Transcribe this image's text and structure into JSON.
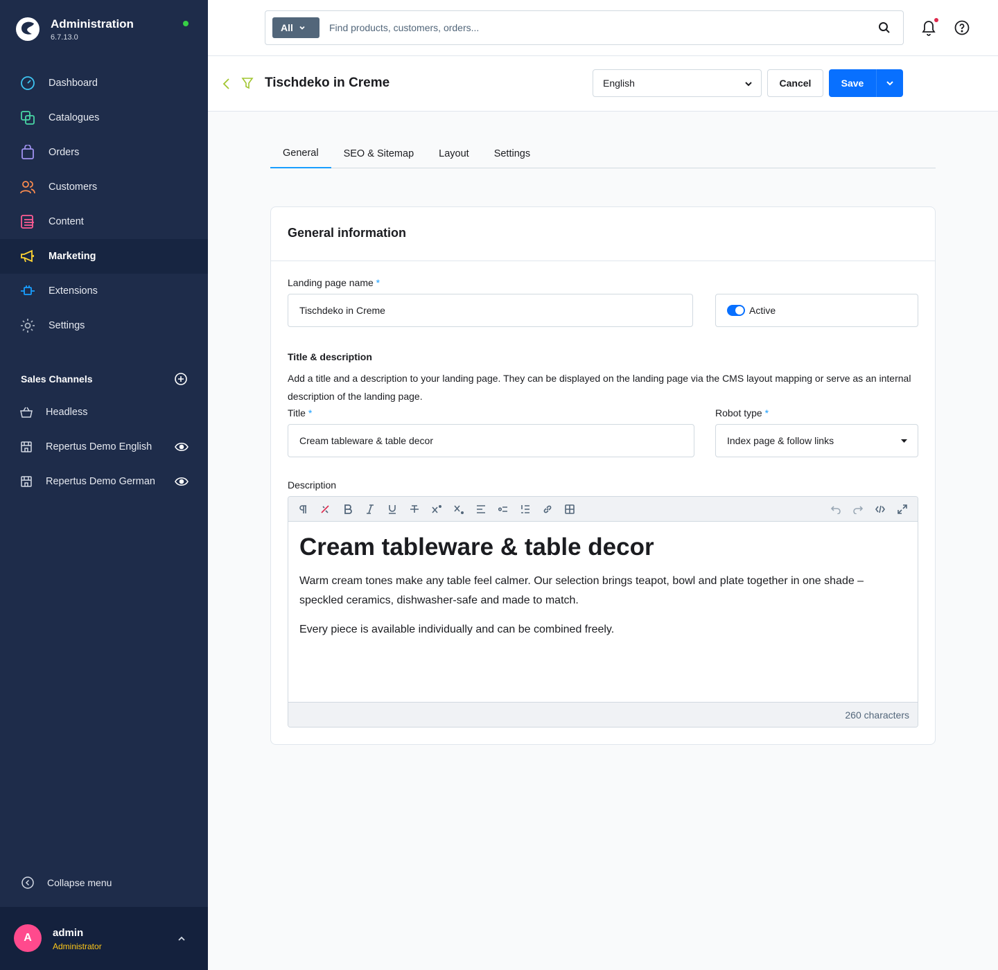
{
  "brand": {
    "title": "Administration",
    "version": "6.7.13.0"
  },
  "nav": {
    "items": [
      {
        "label": "Dashboard",
        "icon": "dashboard-icon"
      },
      {
        "label": "Catalogues",
        "icon": "catalogue-icon"
      },
      {
        "label": "Orders",
        "icon": "shopping-bag-icon"
      },
      {
        "label": "Customers",
        "icon": "users-icon"
      },
      {
        "label": "Content",
        "icon": "content-icon"
      },
      {
        "label": "Marketing",
        "icon": "megaphone-icon",
        "active": true
      },
      {
        "label": "Extensions",
        "icon": "plug-icon"
      },
      {
        "label": "Settings",
        "icon": "gear-icon"
      }
    ]
  },
  "sales_channels": {
    "heading": "Sales Channels",
    "items": [
      {
        "label": "Headless"
      },
      {
        "label": "Repertus Demo English"
      },
      {
        "label": "Repertus Demo German"
      }
    ]
  },
  "sidebar_footer": {
    "collapse_label": "Collapse menu",
    "user_initial": "A",
    "user_name": "admin",
    "user_role": "Administrator"
  },
  "search": {
    "type_label": "All",
    "placeholder": "Find products, customers, orders..."
  },
  "smartbar": {
    "title": "Tischdeko in Creme",
    "language": "English",
    "cancel_label": "Cancel",
    "save_label": "Save"
  },
  "tabs": [
    {
      "label": "General",
      "active": true
    },
    {
      "label": "SEO & Sitemap"
    },
    {
      "label": "Layout"
    },
    {
      "label": "Settings"
    }
  ],
  "card": {
    "title": "General information",
    "name_label": "Landing page name",
    "name_value": "Tischdeko in Creme",
    "active_label": "Active",
    "section_title": "Title & description",
    "section_desc": "Add a title and a description to your landing page. They can be displayed on the landing page via the CMS layout mapping or serve as an internal description of the landing page.",
    "title_label": "Title",
    "title_value": "Cream tableware & table decor",
    "robot_label": "Robot type",
    "robot_value": "Index page & follow links",
    "description_label": "Description",
    "required_mark": "*"
  },
  "editor": {
    "heading": "Cream tableware & table decor",
    "paragraph1": "Warm cream tones make any table feel calmer. Our selection brings teapot, bowl and plate together in one shade – speckled ceramics, dishwasher-safe and made to match.",
    "paragraph2": "Every piece is available individually and can be combined freely.",
    "char_count": "260 characters"
  },
  "colors": {
    "sidebar_bg": "#1e2c4a",
    "accent": "#0870ff",
    "tab_active": "#189eff",
    "role_text": "#ffc819",
    "status_online": "#37d046"
  }
}
